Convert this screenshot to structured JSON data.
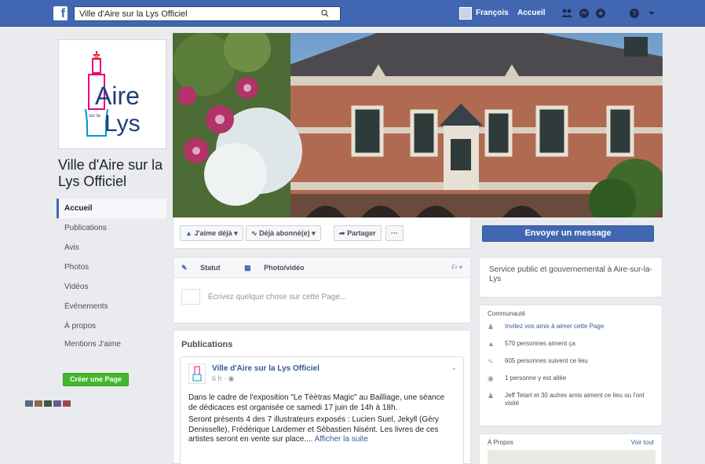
{
  "topbar": {
    "search_value": "Ville d'Aire sur la Lys Officiel",
    "user_name": "François",
    "home_label": "Accueil"
  },
  "profile": {
    "logo_line1": "Aire",
    "logo_line2_small": "sur la",
    "logo_line2": "Lys",
    "page_name": "Ville d'Aire sur la Lys Officiel"
  },
  "left_nav": {
    "items": [
      {
        "label": "Accueil"
      },
      {
        "label": "Publications"
      },
      {
        "label": "Avis"
      },
      {
        "label": "Photos"
      },
      {
        "label": "Vidéos"
      },
      {
        "label": "Événements"
      },
      {
        "label": "À propos"
      },
      {
        "label": "Mentions J'aime"
      }
    ],
    "create_page": "Créer une Page"
  },
  "actions": {
    "like": "J'aime déjà",
    "follow": "Déjà abonné(e)",
    "share": "Partager",
    "more": "···",
    "send_message": "Envoyer un message"
  },
  "composer": {
    "tab_status": "Statut",
    "tab_photo": "Photo/vidéo",
    "lang": "Fr",
    "placeholder": "Écrivez quelque chose sur cette Page..."
  },
  "publications": {
    "header": "Publications",
    "post": {
      "author": "Ville d'Aire sur la Lys Officiel",
      "time": "6 h",
      "para1": "Dans le cadre de l'exposition \"Le Tèètras Magic\" au Bailliage, une séance de dédicaces est organisée ce samedi 17 juin de 14h à 18h.",
      "para2": "Seront présents 4 des 7 illustrateurs exposés : Lucien Suel, Jekyll (Géry Denisselle), Frédérique Lardemer et Sébastien Nisént. Les livres de ces artistes seront en vente sur place....",
      "more": "Afficher la suite"
    }
  },
  "about": {
    "category": "Service public et gouvernemental à Aire-sur-la-Lys"
  },
  "community": {
    "title": "Communauté",
    "rows": [
      {
        "icon": "invite-friends-icon",
        "text": "Invitez vos amis à aimer cette Page"
      },
      {
        "icon": "thumbs-up-icon",
        "text": "570 personnes aiment ça"
      },
      {
        "icon": "rss-icon",
        "text": "605 personnes suivent ce lieu"
      },
      {
        "icon": "checkin-icon",
        "text": "1 personne y est allée"
      },
      {
        "icon": "friends-icon",
        "text": "Jeff Tetart et 30 autres amis aiment ce lieu ou l'ont visité"
      }
    ]
  },
  "apropos": {
    "title": "À Propos",
    "see_all": "Voir tout"
  },
  "colors": {
    "brand_blue": "#4267b2",
    "green": "#42b72a",
    "background": "#e9ebee"
  }
}
